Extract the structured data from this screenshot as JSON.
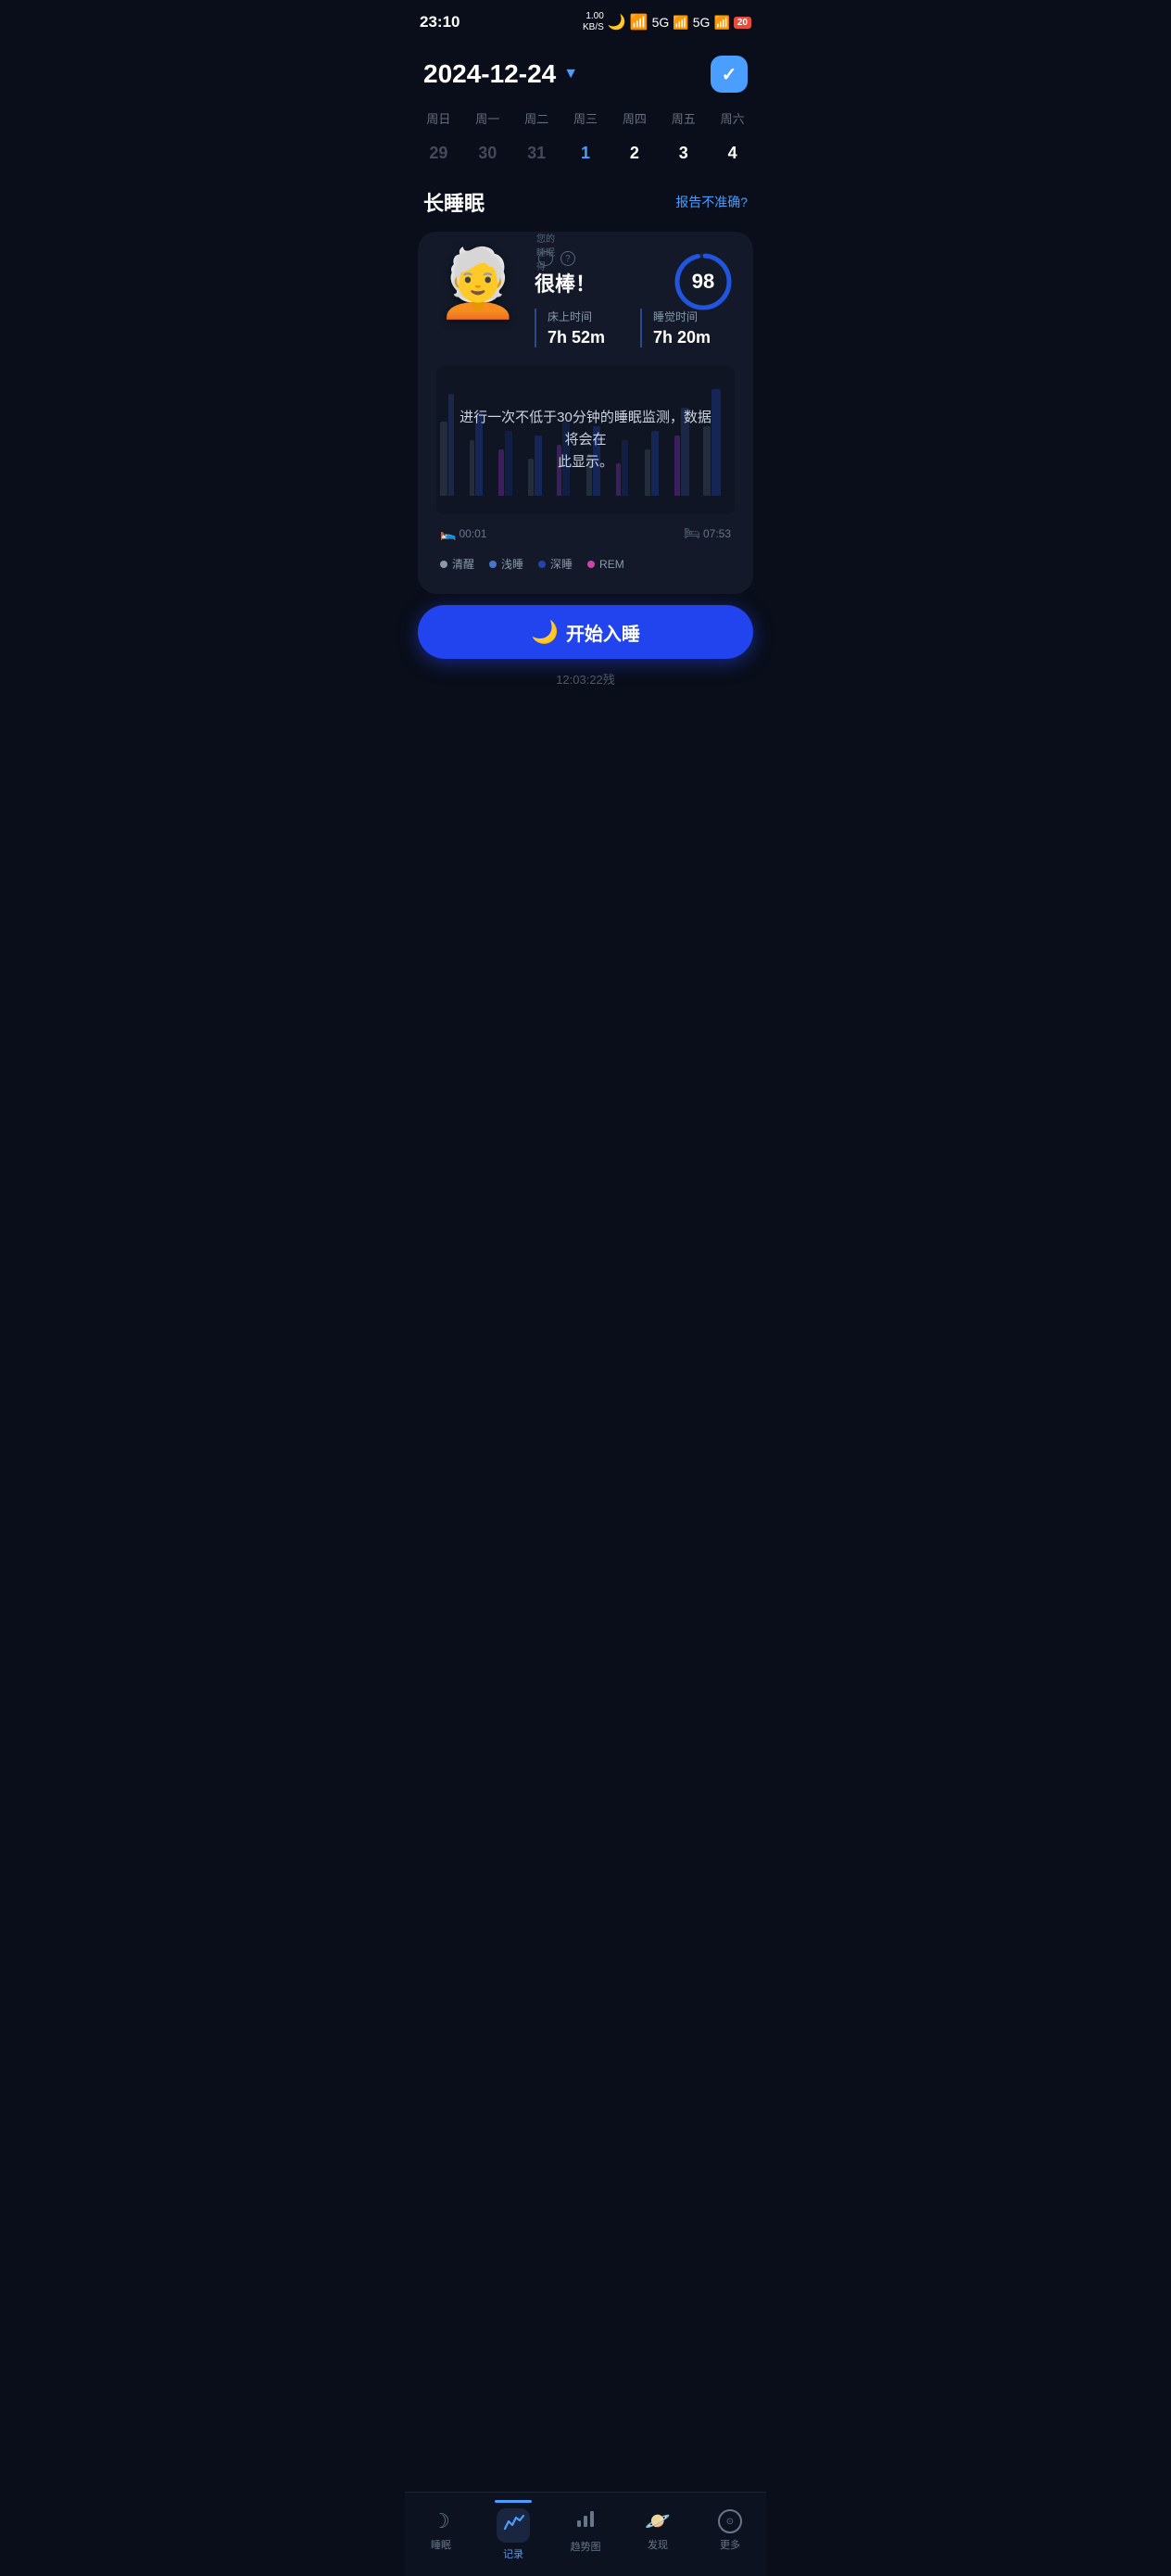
{
  "statusBar": {
    "time": "23:10",
    "networkSpeed": "1.00\nKB/S",
    "batteryLevel": "20"
  },
  "header": {
    "date": "2024-12-24",
    "dropdownArrow": "▼",
    "cloudIcon": "✓"
  },
  "calendar": {
    "weekDayLabels": [
      "周日",
      "周一",
      "周二",
      "周三",
      "周四",
      "周五",
      "周六"
    ],
    "weekDates": [
      "29",
      "30",
      "31",
      "1",
      "2",
      "3",
      "4"
    ],
    "todayIndex": 3
  },
  "section": {
    "title": "长睡眠",
    "reportLink": "报告不准确?"
  },
  "sleepCard": {
    "scoreLabel": "您的睡眠得分：",
    "questionMark": "?",
    "scoreGood": "很棒！",
    "scoreValue": "98",
    "bedTimeLabel": "床上时间",
    "bedTimeValue": "7h 52m",
    "sleepTimeLabel": "睡觉时间",
    "sleepTimeValue": "7h 20m",
    "chartOverlayText": "进行一次不低于30分钟的睡眠监测，数据将会在\n此显示。",
    "startTimeLabel": "00:01",
    "endTimeLabel": "07:53"
  },
  "legend": {
    "items": [
      {
        "label": "清醒",
        "color": "#8899aa"
      },
      {
        "label": "浅睡",
        "color": "#4477cc"
      },
      {
        "label": "深睡",
        "color": "#2244aa"
      },
      {
        "label": "REM",
        "color": "#cc44aa"
      }
    ]
  },
  "startButton": {
    "moonEmoji": "🌙",
    "label": "开始入睡"
  },
  "bottomInfo": {
    "text": "12:03:22残"
  },
  "tabBar": {
    "tabs": [
      {
        "id": "sleep",
        "icon": "☽",
        "label": "睡眠",
        "active": false
      },
      {
        "id": "record",
        "icon": "📈",
        "label": "记录",
        "active": true
      },
      {
        "id": "trend",
        "icon": "📊",
        "label": "趋势图",
        "active": false
      },
      {
        "id": "discover",
        "icon": "🪐",
        "label": "发现",
        "active": false
      },
      {
        "id": "more",
        "icon": "⊙",
        "label": "更多",
        "active": false
      }
    ]
  },
  "colors": {
    "accent": "#4a9eff",
    "background": "#0a0e1a",
    "cardBg": "#131929",
    "barBlue": "#2244aa",
    "barDeep": "#1a3380",
    "barRem": "#8833bb",
    "barGray": "#445566",
    "buttonBg": "#2244ee"
  }
}
